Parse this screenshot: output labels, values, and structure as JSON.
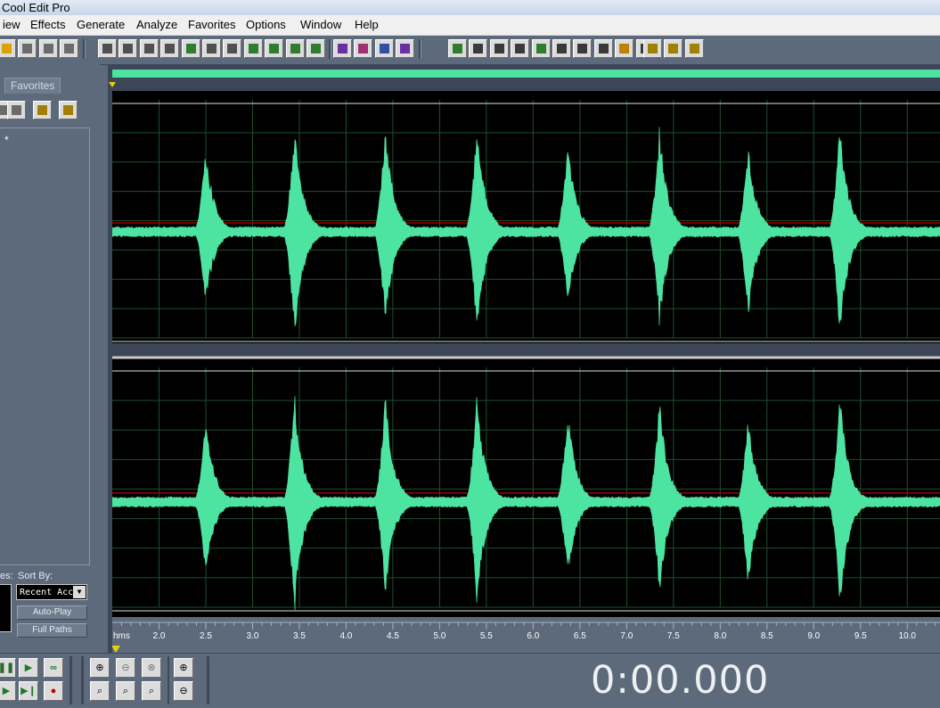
{
  "window": {
    "title": "Cool Edit Pro"
  },
  "menu": [
    "iew",
    "Effects",
    "Generate",
    "Analyze",
    "Favorites",
    "Options",
    "Window",
    "Help"
  ],
  "toolbar": {
    "buttons": [
      {
        "name": "open-file-icon",
        "color": "#d9a300"
      },
      {
        "name": "save-file-icon",
        "color": "#6b6b6b"
      },
      {
        "name": "save-as-icon",
        "color": "#6b6b6b"
      },
      {
        "name": "close-file-icon",
        "color": "#6b6b6b"
      },
      {
        "name": "undo-icon",
        "color": "#505050"
      },
      {
        "name": "redo-icon",
        "color": "#505050"
      },
      {
        "name": "repeat-last-icon",
        "color": "#505050"
      },
      {
        "name": "copy-icon",
        "color": "#505050"
      },
      {
        "name": "copy-to-new-icon",
        "color": "#2f7d2f"
      },
      {
        "name": "cut-icon",
        "color": "#505050"
      },
      {
        "name": "paste-icon",
        "color": "#505050"
      },
      {
        "name": "paste-to-new-icon",
        "color": "#2f7d2f"
      },
      {
        "name": "mix-paste-icon",
        "color": "#2f7d2f"
      },
      {
        "name": "trim-icon",
        "color": "#2f7d2f"
      },
      {
        "name": "insert-icon",
        "color": "#2f7d2f"
      },
      {
        "name": "spectral-view-icon",
        "color": "#6a2fa0"
      },
      {
        "name": "waveform-view-icon",
        "color": "#a03070"
      },
      {
        "name": "mono-view-icon",
        "color": "#3050a0"
      },
      {
        "name": "stereo-view-icon",
        "color": "#6a2fa0"
      },
      {
        "name": "multitrack-view-icon",
        "color": "#2f7d2f"
      },
      {
        "name": "edit-view-icon",
        "color": "#3a3a3a"
      },
      {
        "name": "info-window-icon",
        "color": "#3a3a3a"
      },
      {
        "name": "organizer-icon",
        "color": "#3a3a3a"
      },
      {
        "name": "transport-window-icon",
        "color": "#2f7d2f"
      },
      {
        "name": "zoom-window-icon",
        "color": "#3a3a3a"
      },
      {
        "name": "time-window-icon",
        "color": "#3a3a3a"
      },
      {
        "name": "selection-window-icon",
        "color": "#3a3a3a"
      },
      {
        "name": "level-meter-icon",
        "color": "#c08000"
      },
      {
        "name": "status-bar-icon",
        "color": "#3a3a3a"
      },
      {
        "name": "settings-icon",
        "color": "#a08000"
      },
      {
        "name": "scripts-icon",
        "color": "#a08000"
      },
      {
        "name": "help-icon",
        "color": "#a08000"
      }
    ]
  },
  "organizer": {
    "tab_favorites": "Favorites",
    "file_entry": "*",
    "show_label": "es:",
    "sort_by_label": "Sort By:",
    "sort_value": "Recent Acc",
    "auto_play_label": "Auto-Play",
    "full_paths_label": "Full Paths",
    "mini_buttons": [
      "close-file-icon",
      "insert-icon",
      "settings-icon",
      "help-icon"
    ]
  },
  "ruler": {
    "unit_label": "hms",
    "ticks": [
      "2.0",
      "2.5",
      "3.0",
      "3.5",
      "4.0",
      "4.5",
      "5.0",
      "5.5",
      "6.0",
      "6.5",
      "7.0",
      "7.5",
      "8.0",
      "8.5",
      "9.0",
      "9.5",
      "10.0"
    ]
  },
  "waveform": {
    "wave_color": "#4de3a0",
    "bg_color": "#000000",
    "grid_color": "#1f4f2f",
    "zero_line_color": "#a00000",
    "view_start": 1.5,
    "view_end": 10.35,
    "bursts": [
      {
        "t": 2.5,
        "up": 0.76,
        "down": 0.66
      },
      {
        "t": 3.45,
        "up": 0.96,
        "down": 0.98
      },
      {
        "t": 4.42,
        "up": 0.95,
        "down": 0.82
      },
      {
        "t": 5.4,
        "up": 0.96,
        "down": 0.92
      },
      {
        "t": 6.37,
        "up": 0.82,
        "down": 0.66
      },
      {
        "t": 7.35,
        "up": 0.92,
        "down": 0.82
      },
      {
        "t": 8.3,
        "up": 0.76,
        "down": 0.76
      },
      {
        "t": 9.28,
        "up": 0.96,
        "down": 0.93
      }
    ]
  },
  "transport": {
    "time": "0:00.000"
  }
}
